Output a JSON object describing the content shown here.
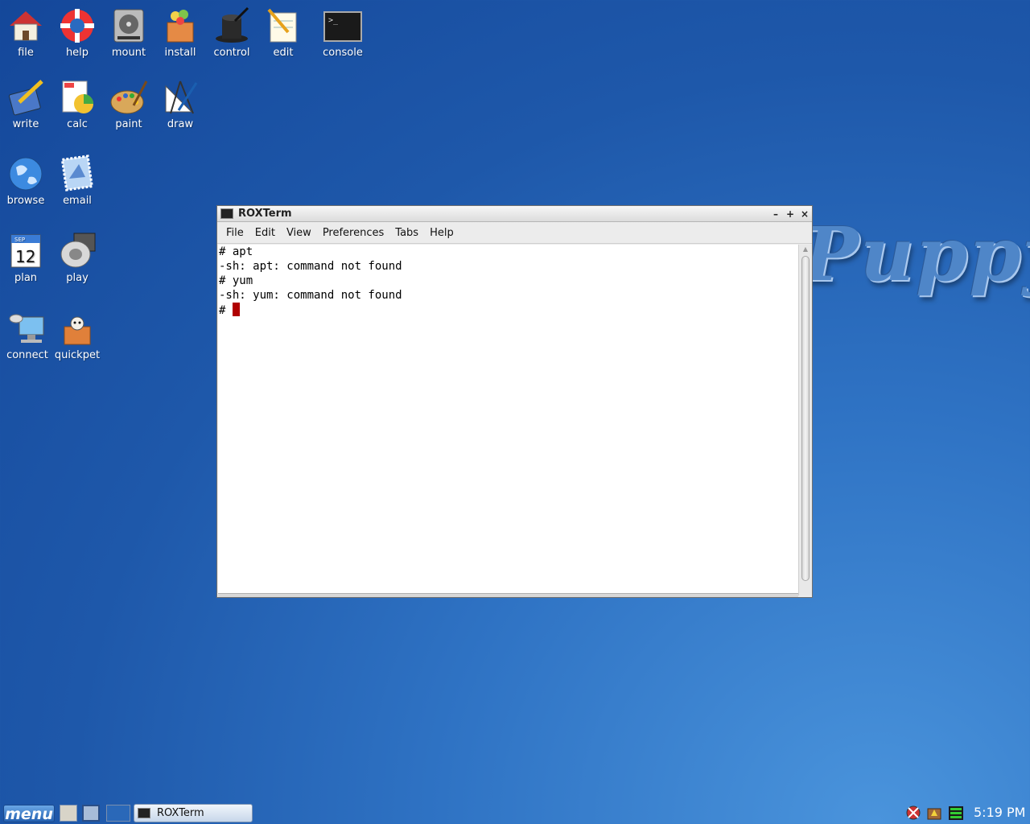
{
  "desktop": {
    "icons": [
      {
        "label": "file"
      },
      {
        "label": "help"
      },
      {
        "label": "mount"
      },
      {
        "label": "install"
      },
      {
        "label": "control"
      },
      {
        "label": "edit"
      },
      {
        "label": "console"
      },
      {
        "label": "write"
      },
      {
        "label": "calc"
      },
      {
        "label": "paint"
      },
      {
        "label": "draw"
      },
      {
        "label": "browse"
      },
      {
        "label": "email"
      },
      {
        "label": "plan"
      },
      {
        "label": "play"
      },
      {
        "label": "connect"
      },
      {
        "label": "quickpet"
      }
    ],
    "plan_icon": {
      "month": "SEP",
      "day": "12"
    },
    "wallpaper_text": "Puppy"
  },
  "window": {
    "title": "ROXTerm",
    "controls": {
      "minimize": "–",
      "maximize": "+",
      "close": "×"
    },
    "menu": [
      "File",
      "Edit",
      "View",
      "Preferences",
      "Tabs",
      "Help"
    ],
    "terminal_lines": [
      "# apt",
      "-sh: apt: command not found",
      "# yum",
      "-sh: yum: command not found",
      "# "
    ]
  },
  "taskbar": {
    "menu_label": "menu",
    "task_label": "ROXTerm",
    "clock": "5:19 PM",
    "tray_icons": [
      "network-disconnected-icon",
      "package-icon",
      "battery-icon"
    ]
  },
  "colors": {
    "desktop": "#2f73c4",
    "cursor": "#b00000",
    "taskbar_task": "#c7d7ea"
  }
}
